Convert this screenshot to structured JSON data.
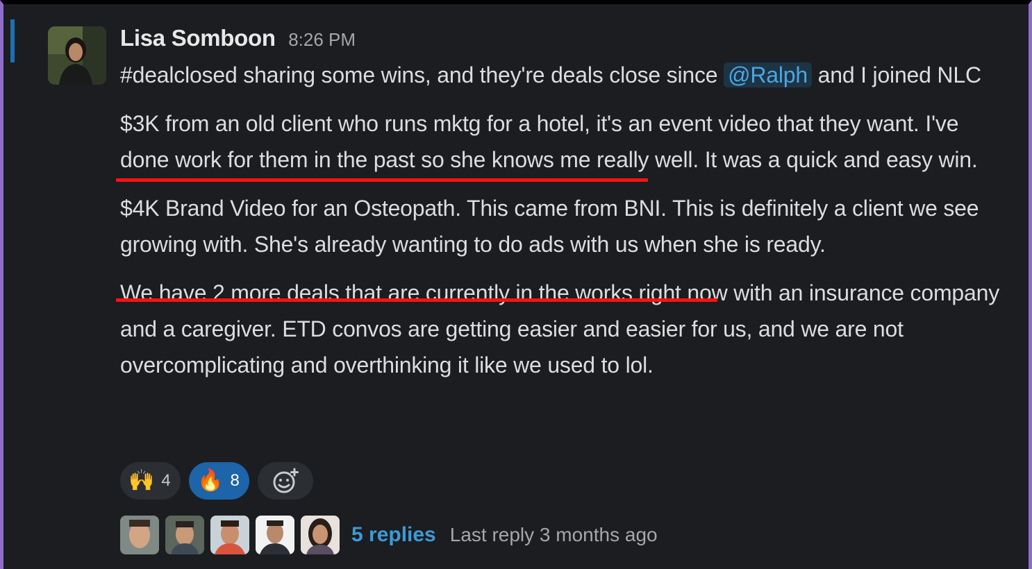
{
  "message": {
    "sender": "Lisa Somboon",
    "time": "8:26 PM",
    "line1_before": "#dealclosed sharing some wins, and they're deals close since ",
    "mention": "@Ralph",
    "line1_after": " and I joined NLC",
    "p2": "$3K from an old client who runs mktg for a hotel, it's an event video that they want. I've done work for them in the past so she knows me really well. It was a quick and easy win.",
    "p3": "$4K Brand Video for an Osteopath. This came from BNI. This is definitely a client we see growing with. She's already wanting to do ads with us when she is ready.",
    "p4": "We have 2 more deals that are currently in the works right now with an insurance company and a caregiver. ETD convos are getting easier and easier for us, and we are not overcomplicating and overthinking it like we used to lol."
  },
  "reactions": [
    {
      "emoji": "🙌",
      "count": "4",
      "active": false
    },
    {
      "emoji": "🔥",
      "count": "8",
      "active": true
    }
  ],
  "add_reaction_icon": "add-emoji-icon",
  "thread": {
    "replies": "5 replies",
    "last_reply": "Last reply 3 months ago"
  },
  "colors": {
    "background": "#1b1d21",
    "mention": "#4aa7e3",
    "link": "#3e9ad6",
    "active_reaction": "#1d64a8",
    "annotation_underline": "#ff1212"
  }
}
